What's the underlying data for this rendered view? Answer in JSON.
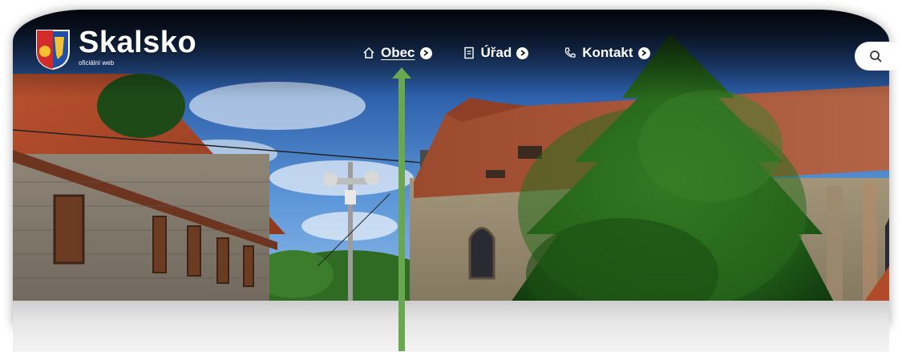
{
  "site": {
    "name": "Skalsko",
    "tagline": "oficiální web"
  },
  "nav": {
    "items": [
      {
        "label": "Obec",
        "icon": "home-icon",
        "active": true
      },
      {
        "label": "Úřad",
        "icon": "document-icon",
        "active": false
      },
      {
        "label": "Kontakt",
        "icon": "phone-icon",
        "active": false
      }
    ]
  },
  "annotation": {
    "color": "#6aa84f"
  },
  "colors": {
    "accent": "#6aa84f",
    "nav_text": "#ffffff"
  }
}
